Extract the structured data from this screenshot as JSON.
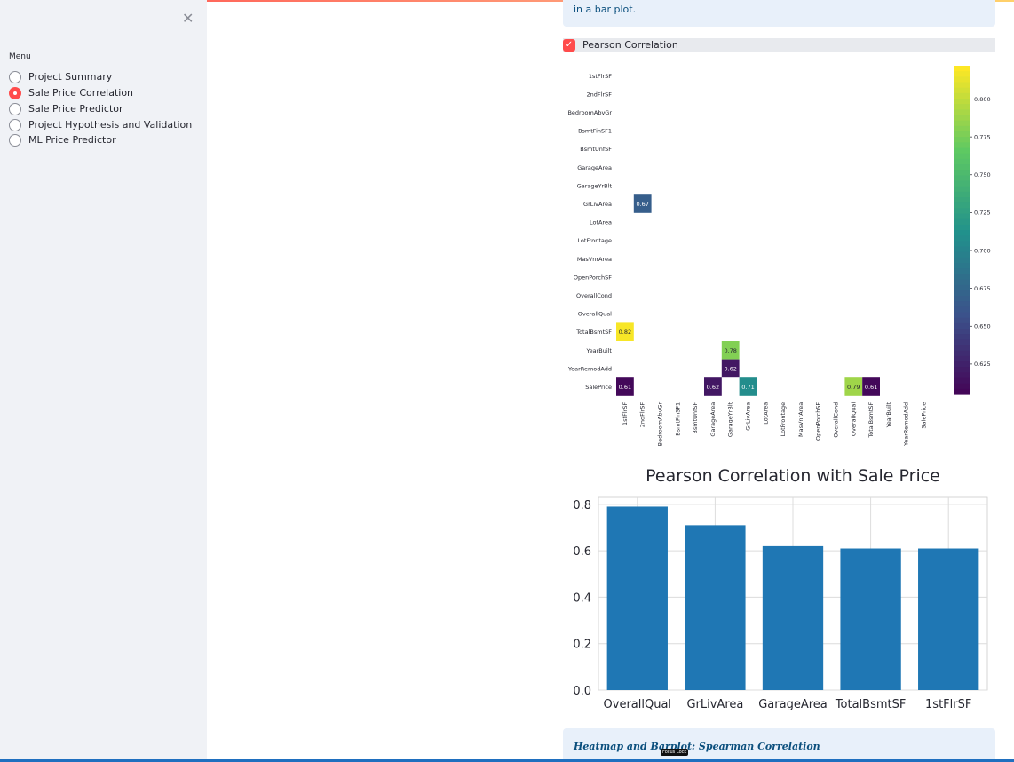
{
  "sidebar": {
    "close_icon": "close-icon",
    "menu_label": "Menu",
    "items": [
      {
        "label": "Project Summary",
        "selected": false
      },
      {
        "label": "Sale Price Correlation",
        "selected": true
      },
      {
        "label": "Sale Price Predictor",
        "selected": false
      },
      {
        "label": "Project Hypothesis and Validation",
        "selected": false
      },
      {
        "label": "ML Price Predictor",
        "selected": false
      }
    ]
  },
  "main": {
    "info_top_text": "in a bar plot.",
    "checkbox": {
      "label": "Pearson Correlation",
      "checked": true
    },
    "info_bottom_text": "Heatmap and Barplot: Spearman Correlation",
    "tooltip_text": "Focus Lock"
  },
  "colors": {
    "accent": "#ff4b4b",
    "bar": "#1f77b4",
    "info_bg": "#e8f0fa"
  },
  "chart_data": [
    {
      "type": "heatmap",
      "variables": [
        "1stFlrSF",
        "2ndFlrSF",
        "BedroomAbvGr",
        "BsmtFinSF1",
        "BsmtUnfSF",
        "GarageArea",
        "GarageYrBlt",
        "GrLivArea",
        "LotArea",
        "LotFrontage",
        "MasVnrArea",
        "OpenPorchSF",
        "OverallCond",
        "OverallQual",
        "TotalBsmtSF",
        "YearBuilt",
        "YearRemodAdd",
        "SalePrice"
      ],
      "cells": [
        {
          "row": "GrLivArea",
          "col": "2ndFlrSF",
          "value": 0.67
        },
        {
          "row": "TotalBsmtSF",
          "col": "1stFlrSF",
          "value": 0.82
        },
        {
          "row": "YearBuilt",
          "col": "GarageYrBlt",
          "value": 0.78
        },
        {
          "row": "YearRemodAdd",
          "col": "GarageYrBlt",
          "value": 0.62
        },
        {
          "row": "SalePrice",
          "col": "1stFlrSF",
          "value": 0.61
        },
        {
          "row": "SalePrice",
          "col": "GarageArea",
          "value": 0.62
        },
        {
          "row": "SalePrice",
          "col": "GrLivArea",
          "value": 0.71
        },
        {
          "row": "SalePrice",
          "col": "OverallQual",
          "value": 0.79
        },
        {
          "row": "SalePrice",
          "col": "TotalBsmtSF",
          "value": 0.61
        }
      ],
      "colorbar": {
        "colormap": "viridis",
        "range": [
          0.605,
          0.822
        ],
        "ticks": [
          "0.800",
          "0.775",
          "0.750",
          "0.725",
          "0.700",
          "0.675",
          "0.650",
          "0.625"
        ]
      }
    },
    {
      "type": "bar",
      "title": "Pearson Correlation with Sale Price",
      "categories": [
        "OverallQual",
        "GrLivArea",
        "GarageArea",
        "TotalBsmtSF",
        "1stFlrSF"
      ],
      "values": [
        0.79,
        0.71,
        0.62,
        0.61,
        0.61
      ],
      "ylim": [
        0,
        0.83
      ],
      "yticks": [
        "0.0",
        "0.2",
        "0.4",
        "0.6",
        "0.8"
      ],
      "grid": true
    }
  ]
}
